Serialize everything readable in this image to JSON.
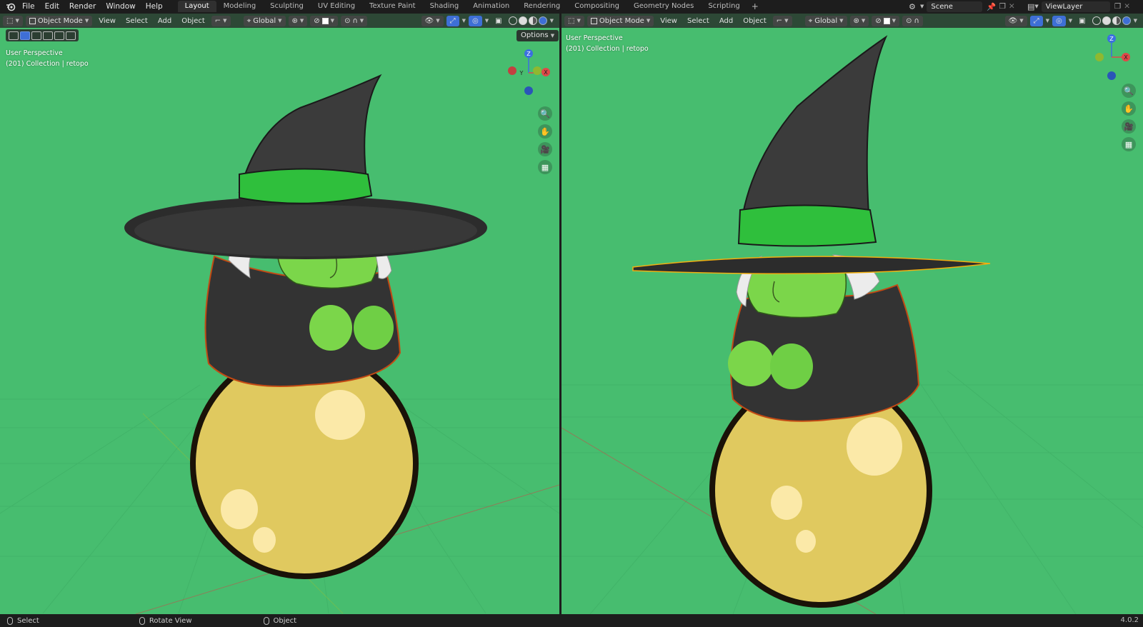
{
  "menubar": {
    "items": [
      "File",
      "Edit",
      "Render",
      "Window",
      "Help"
    ]
  },
  "workspaces": {
    "tabs": [
      "Layout",
      "Modeling",
      "Sculpting",
      "UV Editing",
      "Texture Paint",
      "Shading",
      "Animation",
      "Rendering",
      "Compositing",
      "Geometry Nodes",
      "Scripting"
    ],
    "active": "Layout",
    "add_symbol": "+"
  },
  "scene": {
    "name": "Scene"
  },
  "view_layer": {
    "name": "ViewLayer"
  },
  "left_viewport": {
    "header": {
      "mode": "Object Mode",
      "menus": [
        "View",
        "Select",
        "Add",
        "Object"
      ],
      "transform_orientation": "Global"
    },
    "options_label": "Options",
    "overlay": {
      "view_name": "User Perspective",
      "collection": "(201) Collection | retopo"
    },
    "gizmo": {
      "z": "Z",
      "y": "Y",
      "x": "X"
    }
  },
  "right_viewport": {
    "header": {
      "mode": "Object Mode",
      "menus": [
        "View",
        "Select",
        "Add",
        "Object"
      ],
      "transform_orientation": "Global"
    },
    "overlay": {
      "view_name": "User Perspective",
      "collection": "(201) Collection | retopo"
    },
    "gizmo": {
      "z": "Z",
      "x": "X"
    }
  },
  "statusbar": {
    "select": "Select",
    "rotate_view": "Rotate View",
    "object": "Object",
    "version": "4.0.2"
  },
  "colors": {
    "viewport_bg": "#47bd6f",
    "grid_line": "#3da863",
    "hat": "#3b3b3b",
    "hat_band": "#2fbf3c",
    "skin": "#6fcf45",
    "cauldron": "#e0c95f",
    "cauldron_spot": "#fbe9a8",
    "robe": "#333333",
    "hair": "#e8e8e8",
    "accent_blue": "#3e6fd6"
  }
}
